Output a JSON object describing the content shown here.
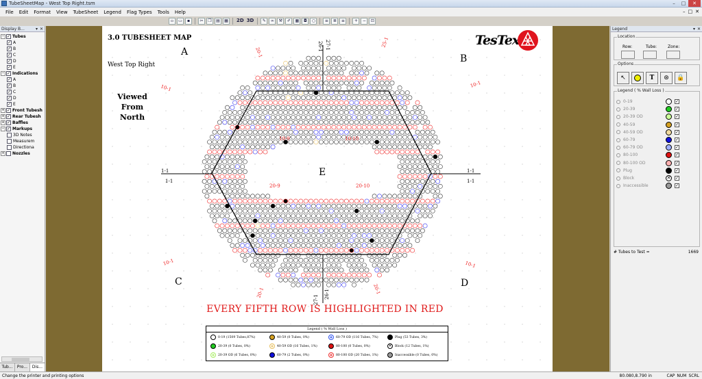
{
  "window": {
    "title": "TubeSheetMap - West Top Right.tsm"
  },
  "menu": [
    "File",
    "Edit",
    "Format",
    "View",
    "TubeSheet",
    "Legend",
    "Flag Types",
    "Tools",
    "Help"
  ],
  "toolbar": {
    "two_d": "2D",
    "three_d": "3D"
  },
  "left_panel": {
    "title": "Display B...",
    "tree": [
      {
        "label": "Tubes",
        "level": 0,
        "checked": true,
        "bold": true,
        "expanded": true
      },
      {
        "label": "A",
        "level": 1,
        "checked": true
      },
      {
        "label": "B",
        "level": 1,
        "checked": true
      },
      {
        "label": "C",
        "level": 1,
        "checked": true
      },
      {
        "label": "D",
        "level": 1,
        "checked": true
      },
      {
        "label": "E",
        "level": 1,
        "checked": true
      },
      {
        "label": "Indications",
        "level": 0,
        "checked": true,
        "bold": true,
        "expanded": true
      },
      {
        "label": "A",
        "level": 1,
        "checked": true
      },
      {
        "label": "B",
        "level": 1,
        "checked": true
      },
      {
        "label": "C",
        "level": 1,
        "checked": true
      },
      {
        "label": "D",
        "level": 1,
        "checked": true
      },
      {
        "label": "E",
        "level": 1,
        "checked": true
      },
      {
        "label": "Front Tubesh",
        "level": 0,
        "checked": true,
        "bold": true,
        "expanded": false
      },
      {
        "label": "Rear Tubesh",
        "level": 0,
        "checked": true,
        "bold": true,
        "expanded": false
      },
      {
        "label": "Baffles",
        "level": 0,
        "checked": true,
        "bold": true,
        "expanded": false
      },
      {
        "label": "Markups",
        "level": 0,
        "checked": true,
        "bold": true,
        "expanded": true
      },
      {
        "label": "3D Notes",
        "level": 1,
        "checked": false
      },
      {
        "label": "Measurem",
        "level": 1,
        "checked": false
      },
      {
        "label": "Directiona",
        "level": 1,
        "checked": false
      },
      {
        "label": "Nozzles",
        "level": 0,
        "checked": false,
        "bold": true,
        "expanded": false
      }
    ],
    "tabs": [
      "Tub...",
      "Pro...",
      "Dis..."
    ]
  },
  "page": {
    "title": "3.0 TUBESHEET MAP",
    "subtitle": "West Top Right",
    "viewed": [
      "Viewed",
      "From",
      "North"
    ],
    "logo_text": "TesTex",
    "banner": "EVERY FIFTH ROW IS HIGHLIGHTED IN RED",
    "quadrants": {
      "A": "A",
      "B": "B",
      "C": "C",
      "D": "D",
      "E": "E"
    },
    "row_labels": {
      "top_20": "20-1",
      "top_26": "26-1",
      "top_27": "27-1",
      "top_25": "25-1",
      "left_10": "10-1",
      "right_10": "10-1",
      "left_1a": "1-1",
      "left_1b": "1-1",
      "right_1a": "1-1",
      "right_1b": "1-1",
      "in_10_9": "10-9",
      "in_10_10": "10-10",
      "in_20_9": "20-9",
      "in_20_10": "20-10",
      "bl_10": "10-1",
      "br_10": "10-1",
      "bot_20": "20-1",
      "bot_27": "27-1",
      "bot_26": "26-1",
      "bot_25": "20-1"
    },
    "legend": {
      "title": "Legend ( % Wall Loss )",
      "items": [
        {
          "label": "0-19 (1509 Tubes,87%)",
          "color": "#ffffff",
          "style": "solid"
        },
        {
          "label": "20-39 (0 Tubes, 0%)",
          "color": "#22cc22",
          "style": "solid"
        },
        {
          "label": "20-39 OD (6 Tubes, 0%)",
          "color": "#aaee66",
          "style": "od"
        },
        {
          "label": "40-59 (0 Tubes, 0%)",
          "color": "#d4a022",
          "style": "solid"
        },
        {
          "label": "40-59 OD (16 Tubes, 1%)",
          "color": "#e8c060",
          "style": "od"
        },
        {
          "label": "60-79 (2 Tubes, 0%)",
          "color": "#1010dd",
          "style": "solid"
        },
        {
          "label": "60-79 OD (116 Tubes, 7%)",
          "color": "#3355ee",
          "style": "od"
        },
        {
          "label": "80-100 (0 Tubes, 0%)",
          "color": "#dd1111",
          "style": "solid"
        },
        {
          "label": "80-100 OD (20 Tubes, 1%)",
          "color": "#ee3333",
          "style": "od"
        },
        {
          "label": "Plug (53 Tubes, 3%)",
          "color": "#000000",
          "style": "solid"
        },
        {
          "label": "Block (12 Tubes, 1%)",
          "color": "#ffffff",
          "style": "x"
        },
        {
          "label": "Inaccessible (0 Tubes, 0%)",
          "color": "#999999",
          "style": "solid"
        }
      ]
    }
  },
  "right_panel": {
    "title": "Legend",
    "location_group": "Location",
    "location_fields": [
      "Row:",
      "Tube:",
      "Zone:"
    ],
    "options_group": "Options",
    "legend_group": "Legend ( % Wall Loss )",
    "rows": [
      {
        "label": "0-19",
        "color": "#ffffff"
      },
      {
        "label": "20-39",
        "color": "#22cc22"
      },
      {
        "label": "20-39 OD",
        "color": "#ccff99"
      },
      {
        "label": "40-59",
        "color": "#d4a022"
      },
      {
        "label": "40-59 OD",
        "color": "#f2dca0"
      },
      {
        "label": "60-79",
        "color": "#1010dd"
      },
      {
        "label": "60-79 OD",
        "color": "#a0b0ff"
      },
      {
        "label": "80-100",
        "color": "#dd1111"
      },
      {
        "label": "80-100 OD",
        "color": "#ffb0b0"
      },
      {
        "label": "Plug",
        "color": "#000000"
      },
      {
        "label": "Block",
        "color": "#ffffff"
      },
      {
        "label": "Inaccessible",
        "color": "#999999"
      }
    ],
    "tubes_to_test_label": "# Tubes to Test =",
    "tubes_to_test_value": "1669"
  },
  "status": {
    "message": "Change the printer and printing options",
    "coords": "80.080,8.790 in",
    "flags": [
      "CAP",
      "NUM",
      "SCRL"
    ]
  }
}
